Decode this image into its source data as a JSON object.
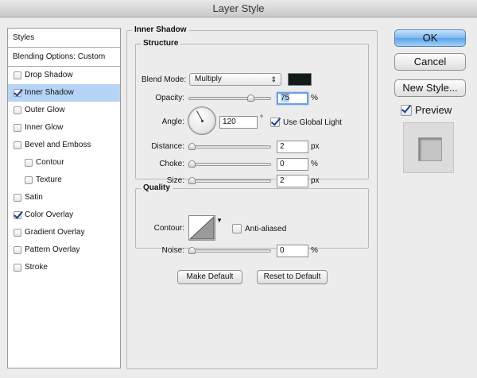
{
  "window": {
    "title": "Layer Style"
  },
  "styles_panel": {
    "header": "Styles",
    "blending_options": "Blending Options: Custom",
    "items": [
      {
        "label": "Drop Shadow",
        "checked": false,
        "selected": false,
        "sub": false
      },
      {
        "label": "Inner Shadow",
        "checked": true,
        "selected": true,
        "sub": false
      },
      {
        "label": "Outer Glow",
        "checked": false,
        "selected": false,
        "sub": false
      },
      {
        "label": "Inner Glow",
        "checked": false,
        "selected": false,
        "sub": false
      },
      {
        "label": "Bevel and Emboss",
        "checked": false,
        "selected": false,
        "sub": false
      },
      {
        "label": "Contour",
        "checked": false,
        "selected": false,
        "sub": true
      },
      {
        "label": "Texture",
        "checked": false,
        "selected": false,
        "sub": true
      },
      {
        "label": "Satin",
        "checked": false,
        "selected": false,
        "sub": false
      },
      {
        "label": "Color Overlay",
        "checked": true,
        "selected": false,
        "sub": false
      },
      {
        "label": "Gradient Overlay",
        "checked": false,
        "selected": false,
        "sub": false
      },
      {
        "label": "Pattern Overlay",
        "checked": false,
        "selected": false,
        "sub": false
      },
      {
        "label": "Stroke",
        "checked": false,
        "selected": false,
        "sub": false
      }
    ]
  },
  "inner_shadow": {
    "title": "Inner Shadow",
    "structure": {
      "title": "Structure",
      "blend_mode_label": "Blend Mode:",
      "blend_mode_value": "Multiply",
      "shadow_color": "#121a1a",
      "opacity_label": "Opacity:",
      "opacity_value": "75",
      "opacity_unit": "%",
      "angle_label": "Angle:",
      "angle_value": "120",
      "angle_unit": "°",
      "use_global_light_label": "Use Global Light",
      "use_global_light_checked": true,
      "distance_label": "Distance:",
      "distance_value": "2",
      "distance_unit": "px",
      "choke_label": "Choke:",
      "choke_value": "0",
      "choke_unit": "%",
      "size_label": "Size:",
      "size_value": "2",
      "size_unit": "px"
    },
    "quality": {
      "title": "Quality",
      "contour_label": "Contour:",
      "anti_aliased_label": "Anti-aliased",
      "anti_aliased_checked": false,
      "noise_label": "Noise:",
      "noise_value": "0",
      "noise_unit": "%"
    },
    "make_default_label": "Make Default",
    "reset_default_label": "Reset to Default"
  },
  "actions": {
    "ok_label": "OK",
    "cancel_label": "Cancel",
    "new_style_label": "New Style...",
    "preview_label": "Preview",
    "preview_checked": true
  },
  "icons": {
    "select_arrows": "⇕",
    "contour_dropdown": "▼"
  }
}
